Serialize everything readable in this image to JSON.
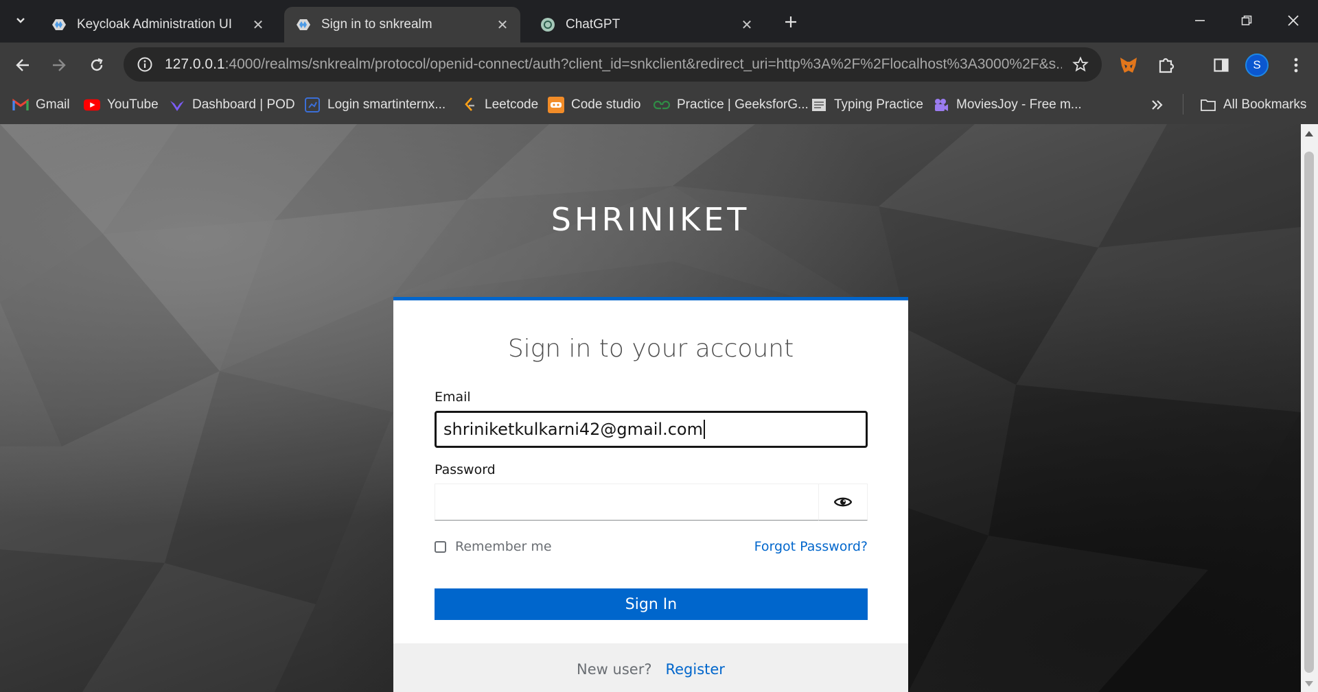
{
  "tabs": [
    {
      "title": "Keycloak Administration UI",
      "icon": "keycloak-icon"
    },
    {
      "title": "Sign in to snkrealm",
      "icon": "keycloak-icon"
    },
    {
      "title": "ChatGPT",
      "icon": "chatgpt-icon"
    }
  ],
  "omnibox": {
    "host": "127.0.0.1",
    "path": ":4000/realms/snkrealm/protocol/openid-connect/auth?client_id=snkclient&redirect_uri=http%3A%2F%2Flocalhost%3A3000%2F&s..."
  },
  "profile": {
    "initial": "S"
  },
  "bookmarks": [
    {
      "label": "Gmail",
      "icon": "gmail-icon"
    },
    {
      "label": "YouTube",
      "icon": "youtube-icon"
    },
    {
      "label": "Dashboard | POD",
      "icon": "pod-icon"
    },
    {
      "label": "Login smartinternx...",
      "icon": "smartinternz-icon"
    },
    {
      "label": "Leetcode",
      "icon": "leetcode-icon"
    },
    {
      "label": "Code studio",
      "icon": "codestudio-icon"
    },
    {
      "label": "Practice | GeeksforG...",
      "icon": "gfg-icon"
    },
    {
      "label": "Typing Practice",
      "icon": "typing-icon"
    },
    {
      "label": "MoviesJoy - Free m...",
      "icon": "moviesjoy-icon"
    }
  ],
  "all_bookmarks": "All Bookmarks",
  "login": {
    "realm_name": "SHRINIKET",
    "title": "Sign in to your account",
    "email_label": "Email",
    "email_value": "shriniketkulkarni42@gmail.com",
    "password_label": "Password",
    "remember_me": "Remember me",
    "forgot_password": "Forgot Password?",
    "sign_in": "Sign In",
    "new_user": "New user?",
    "register": "Register"
  },
  "colors": {
    "accent": "#0066cc",
    "chrome_bg": "#202124",
    "toolbar_bg": "#3c3c3c"
  }
}
